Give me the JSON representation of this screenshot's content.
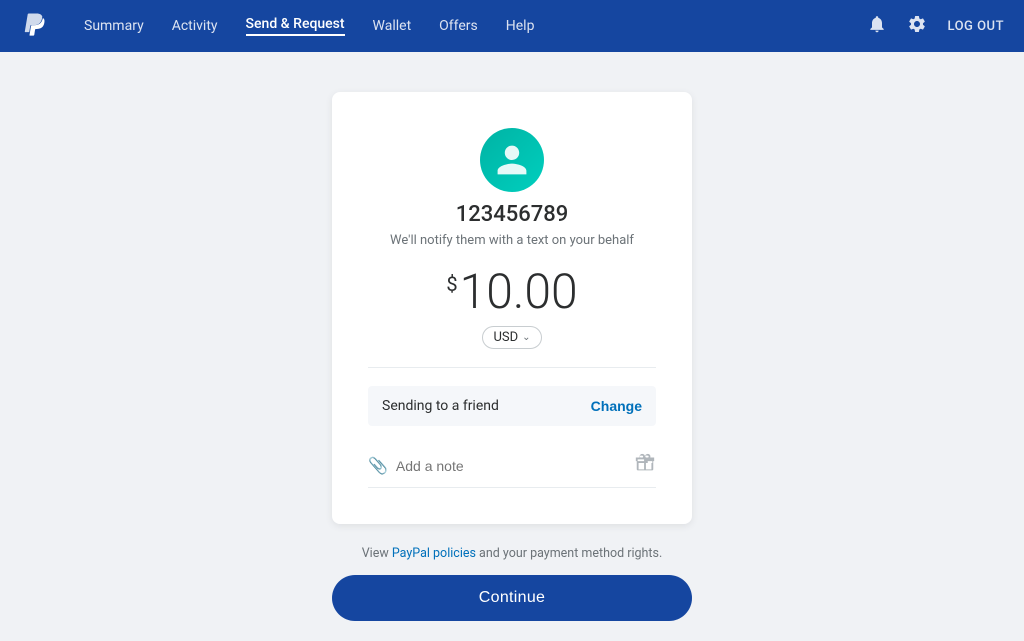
{
  "nav": {
    "logo_alt": "PayPal",
    "links": [
      {
        "label": "Summary",
        "active": false
      },
      {
        "label": "Activity",
        "active": false
      },
      {
        "label": "Send & Request",
        "active": true
      },
      {
        "label": "Wallet",
        "active": false
      },
      {
        "label": "Offers",
        "active": false
      },
      {
        "label": "Help",
        "active": false
      }
    ],
    "logout_label": "LOG OUT"
  },
  "card": {
    "recipient_name": "123456789",
    "notify_text": "We'll notify them with a text on your behalf",
    "amount_symbol": "$",
    "amount_value": "10.00",
    "currency": "USD",
    "send_type_label": "Sending to a friend",
    "change_button_label": "Change",
    "note_placeholder": "Add a note"
  },
  "footer": {
    "prefix_text": "View ",
    "link_text": "PayPal policies",
    "suffix_text": " and your payment method rights."
  },
  "continue_button_label": "Continue"
}
